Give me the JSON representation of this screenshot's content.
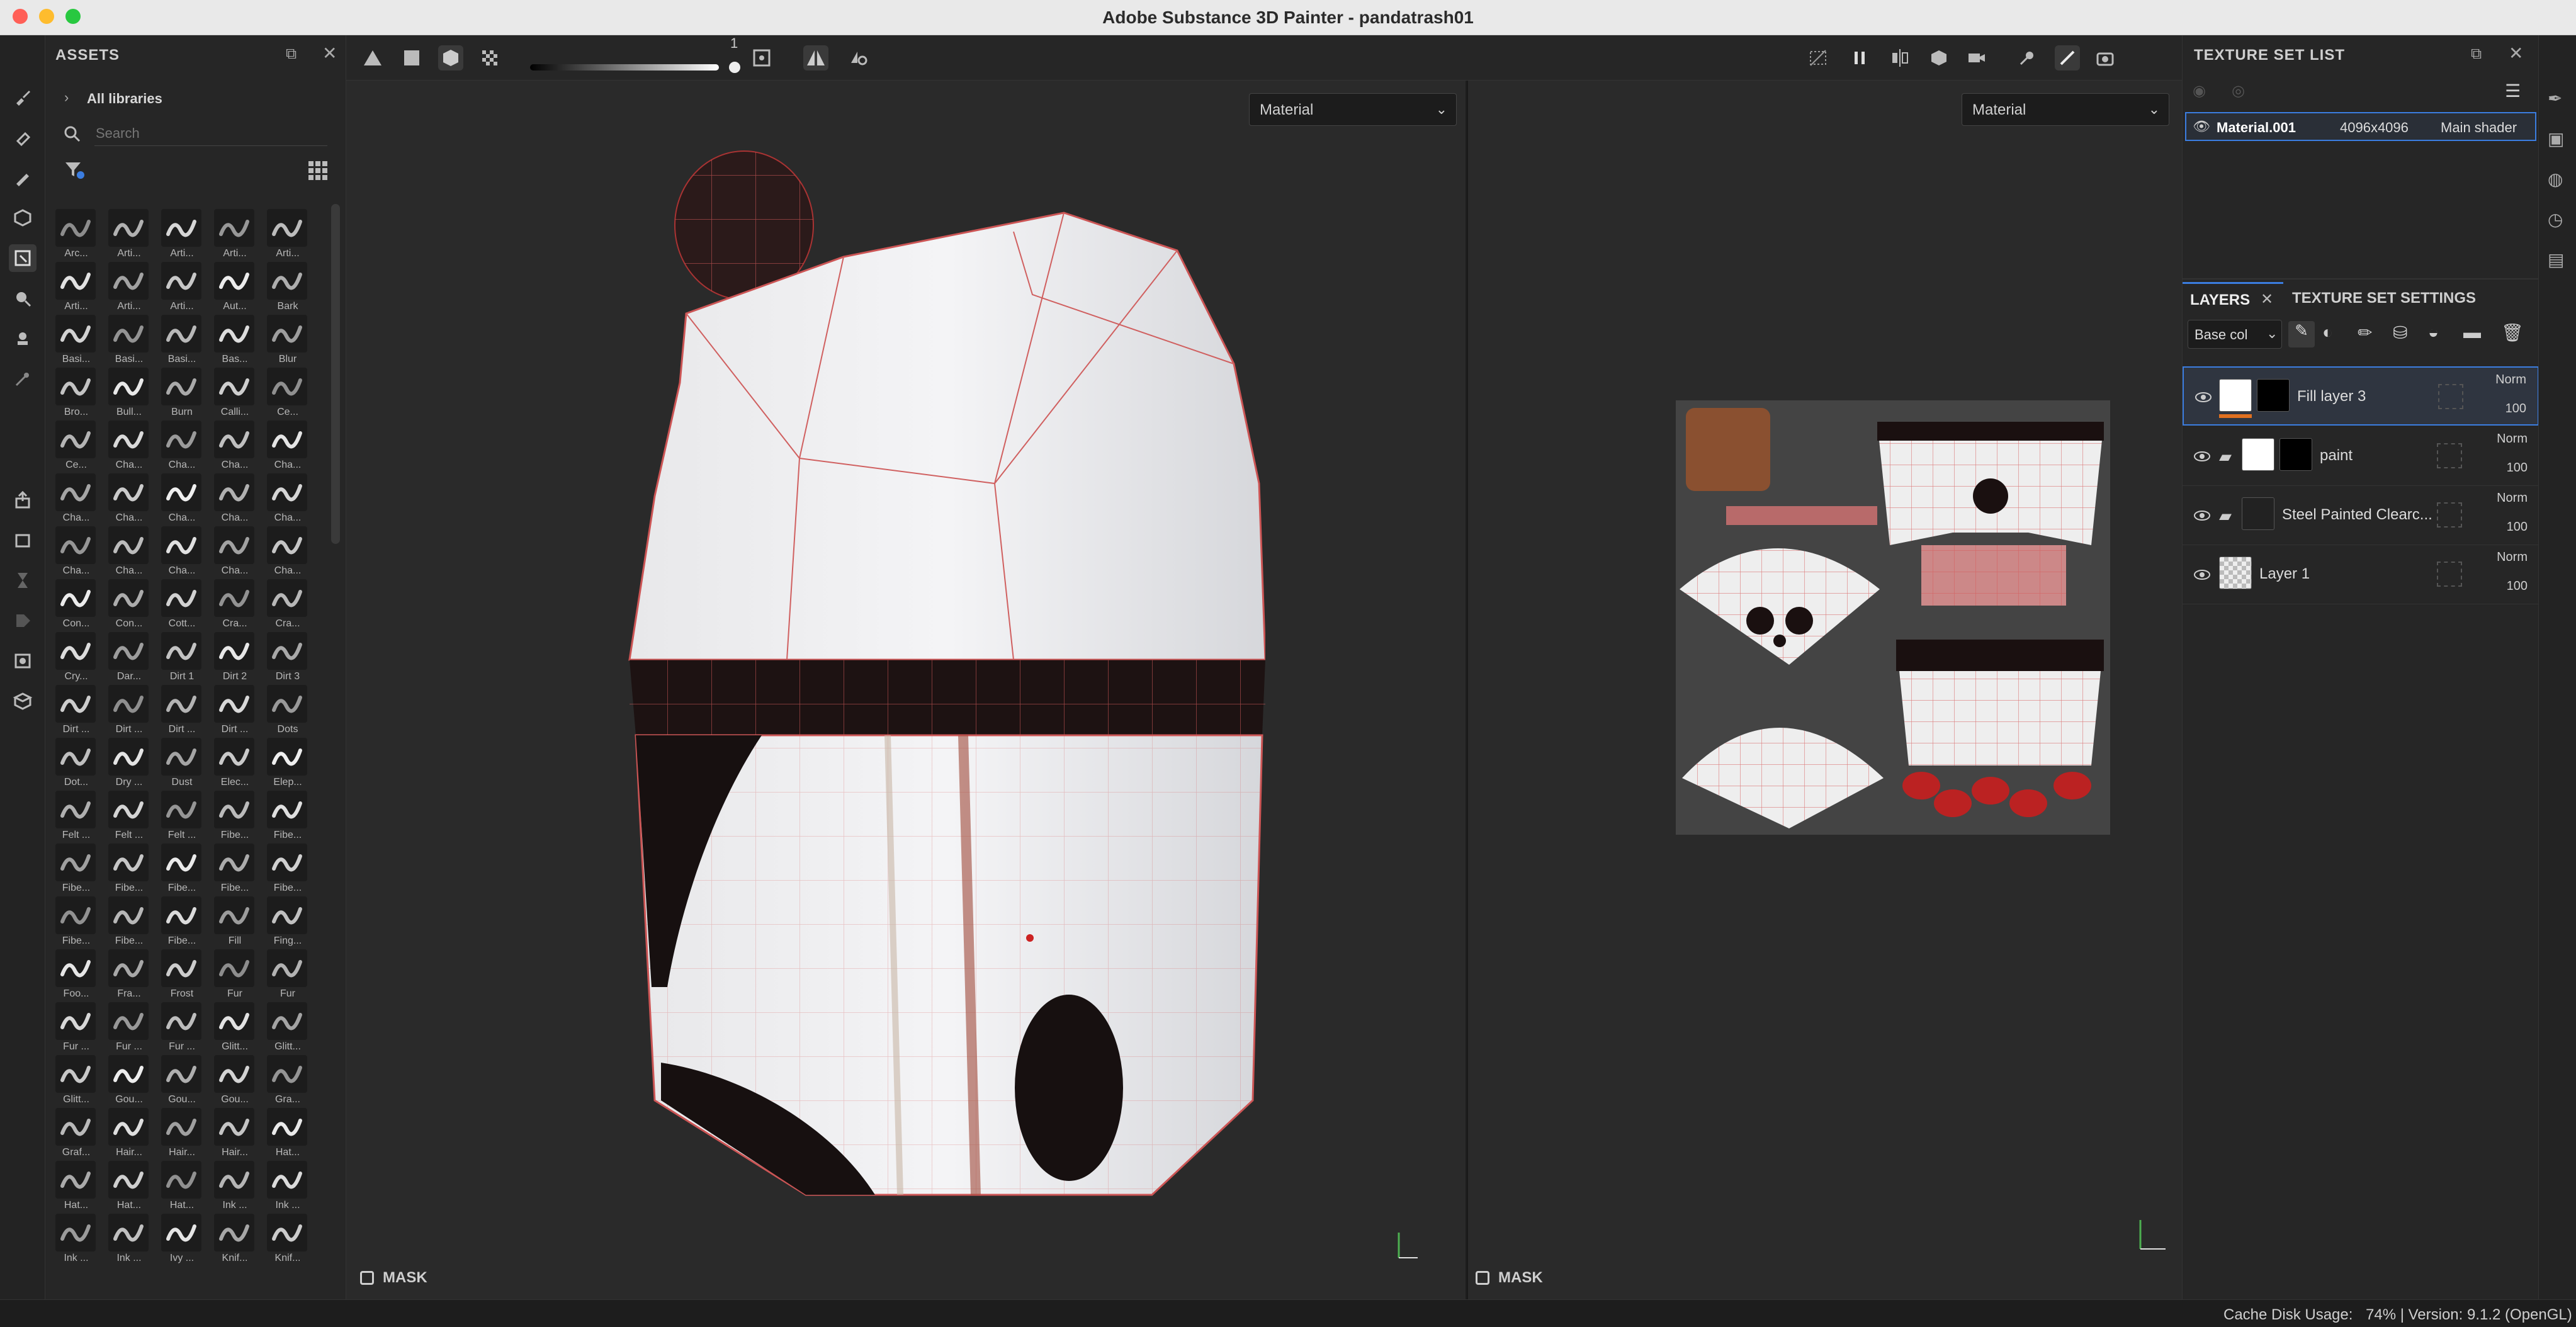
{
  "window": {
    "title": "Adobe Substance 3D Painter - pandatrash01"
  },
  "assets": {
    "title": "ASSETS",
    "breadcrumb": "All libraries",
    "search_placeholder": "Search",
    "items": [
      "Arc...",
      "Arti...",
      "Arti...",
      "Arti...",
      "Arti...",
      "Arti...",
      "Arti...",
      "Arti...",
      "Aut...",
      "Bark",
      "Basi...",
      "Basi...",
      "Basi...",
      "Bas...",
      "Blur",
      "Bro...",
      "Bull...",
      "Burn",
      "Calli...",
      "Ce...",
      "Ce...",
      "Cha...",
      "Cha...",
      "Cha...",
      "Cha...",
      "Cha...",
      "Cha...",
      "Cha...",
      "Cha...",
      "Cha...",
      "Cha...",
      "Cha...",
      "Cha...",
      "Cha...",
      "Cha...",
      "Con...",
      "Con...",
      "Cott...",
      "Cra...",
      "Cra...",
      "Cry...",
      "Dar...",
      "Dirt 1",
      "Dirt 2",
      "Dirt 3",
      "Dirt ...",
      "Dirt ...",
      "Dirt ...",
      "Dirt ...",
      "Dots",
      "Dot...",
      "Dry ...",
      "Dust",
      "Elec...",
      "Elep...",
      "Felt ...",
      "Felt ...",
      "Felt ...",
      "Fibe...",
      "Fibe...",
      "Fibe...",
      "Fibe...",
      "Fibe...",
      "Fibe...",
      "Fibe...",
      "Fibe...",
      "Fibe...",
      "Fibe...",
      "Fill",
      "Fing...",
      "Foo...",
      "Fra...",
      "Frost",
      "Fur",
      "Fur",
      "Fur ...",
      "Fur ...",
      "Fur ...",
      "Glitt...",
      "Glitt...",
      "Glitt...",
      "Gou...",
      "Gou...",
      "Gou...",
      "Gra...",
      "Graf...",
      "Hair...",
      "Hair...",
      "Hair...",
      "Hat...",
      "Hat...",
      "Hat...",
      "Hat...",
      "Ink ...",
      "Ink ...",
      "Ink ...",
      "Ink ...",
      "Ivy ...",
      "Knif...",
      "Knif..."
    ]
  },
  "toolbar": {
    "slider_value": "1"
  },
  "viewport3d": {
    "mode": "Material",
    "mask_label": "MASK"
  },
  "viewport2d": {
    "mode": "Material",
    "mask_label": "MASK"
  },
  "texture_set_list": {
    "title": "TEXTURE SET LIST",
    "material": {
      "name": "Material.001",
      "resolution": "4096x4096",
      "shader": "Main shader"
    }
  },
  "layers_panel": {
    "tab_layers": "LAYERS",
    "tab_settings": "TEXTURE SET SETTINGS",
    "channel": "Base col",
    "layers": [
      {
        "name": "Fill layer 3",
        "blend": "Norm",
        "opacity": "100"
      },
      {
        "name": "paint",
        "blend": "Norm",
        "opacity": "100"
      },
      {
        "name": "Steel Painted Clearc...",
        "blend": "Norm",
        "opacity": "100"
      },
      {
        "name": "Layer 1",
        "blend": "Norm",
        "opacity": "100"
      }
    ]
  },
  "status": {
    "cache_label": "Cache Disk Usage:",
    "cache_value": "74% | Version: 9.1.2 (OpenGL)"
  }
}
